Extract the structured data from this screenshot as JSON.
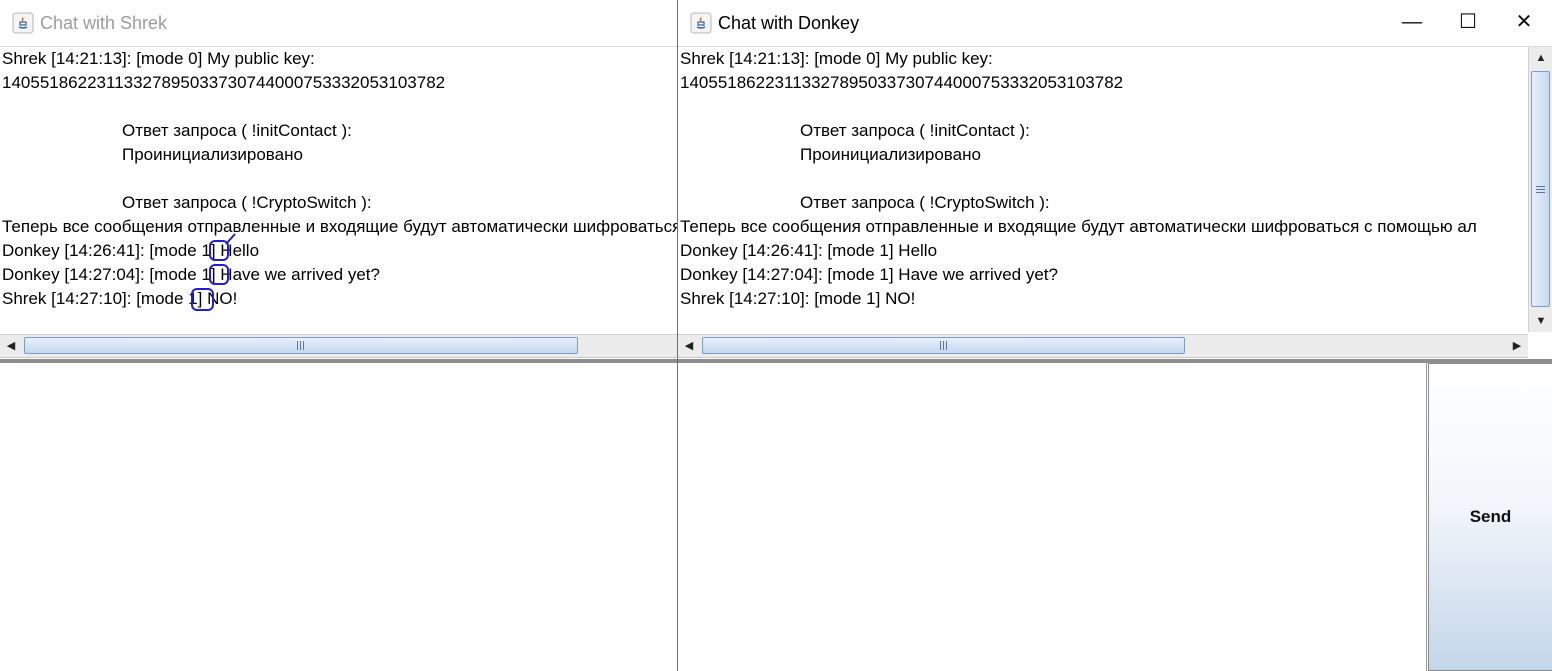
{
  "windows": {
    "shrek": {
      "title": "Chat with Shrek",
      "icon": "java-icon",
      "messages": [
        "Shrek [14:21:13]: [mode 0] My public key:",
        "140551862231133278950337307440007533320531037​82",
        "Ответ запроса ( !initContact ):",
        "Проинициализировано",
        "Ответ запроса ( !CryptoSwitch ):",
        "Теперь все сообщения отправленные и входящие будут автоматически шифроваться с помощью ал",
        "Donkey [14:26:41]: [mode 1] Hello",
        "Donkey [14:27:04]: [mode 1] Have we arrived yet?",
        "Shrek [14:27:10]: [mode 1] NO!"
      ],
      "input_value": ""
    },
    "donkey": {
      "title": "Chat with Donkey",
      "icon": "java-icon",
      "controls": {
        "minimize": "—",
        "maximize": "☐",
        "close": "✕"
      },
      "messages": [
        "Shrek [14:21:13]: [mode 0] My public key:",
        "140551862231133278950337307440007533320531037​82",
        "Ответ запроса ( !initContact ):",
        "Проинициализировано",
        "Ответ запроса ( !CryptoSwitch ):",
        "Теперь все сообщения отправленные и входящие будут автоматически шифроваться с помощью ал",
        "Donkey [14:26:41]: [mode 1] Hello",
        "Donkey [14:27:04]: [mode 1] Have we arrived yet?",
        "Shrek [14:27:10]: [mode 1] NO!"
      ],
      "input_value": "",
      "send_label": "Send"
    }
  },
  "colors": {
    "annotation_marker": "#1f1fd0",
    "scroll_thumb_border": "#7c9ccf",
    "active_window_border": "#2a7bd8"
  }
}
